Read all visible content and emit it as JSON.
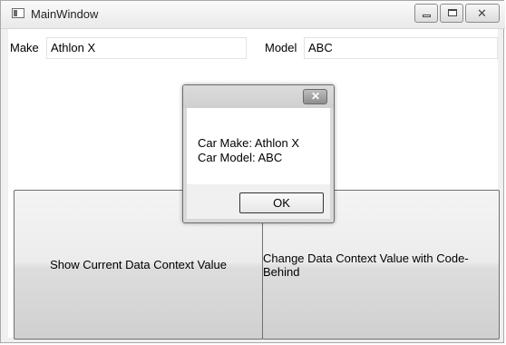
{
  "window": {
    "title": "MainWindow"
  },
  "form": {
    "make_label": "Make",
    "make_value": "Athlon X",
    "model_label": "Model",
    "model_value": "ABC"
  },
  "buttons": {
    "show_label": "Show Current Data Context Value",
    "change_label": "Change Data Context Value with Code-Behind"
  },
  "dialog": {
    "line1": "Car Make: Athlon X",
    "line2": "Car Model: ABC",
    "ok_label": "OK"
  },
  "icons": [
    "window-app-icon",
    "minimize-icon",
    "maximize-icon",
    "close-icon",
    "dialog-close-icon"
  ]
}
